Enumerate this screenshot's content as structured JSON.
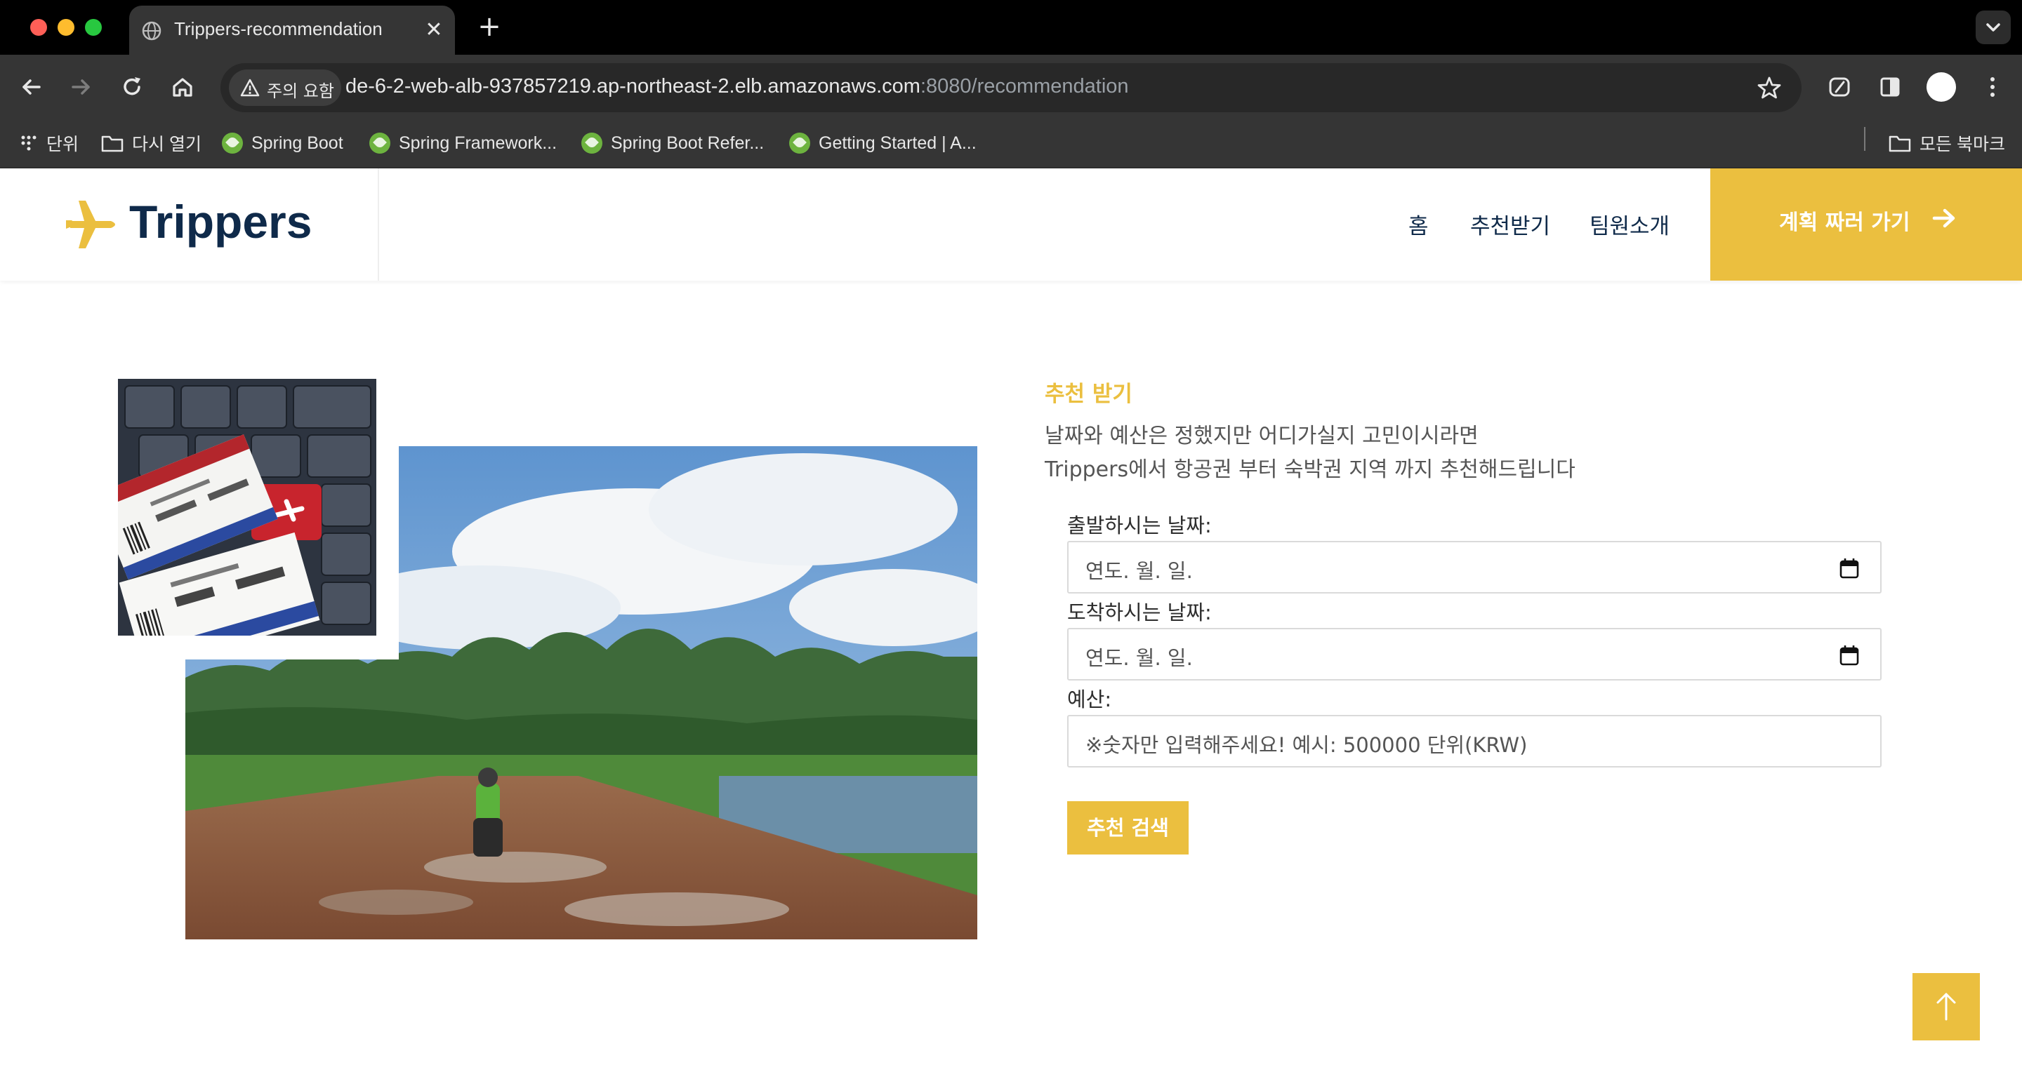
{
  "browser": {
    "tab_title": "Trippers-recommendation",
    "new_tab_symbol": "+",
    "close_symbol": "✕",
    "security_chip": "주의 요함",
    "url_host": "de-6-2-web-alb-937857219.ap-northeast-2.elb.amazonaws.com",
    "url_rest": ":8080/recommendation",
    "bookmarks": [
      {
        "label": "단위",
        "icon": "apps-grid-icon"
      },
      {
        "label": "다시 열기",
        "icon": "folder-icon"
      },
      {
        "label": "Spring Boot",
        "icon": "spring-leaf-icon"
      },
      {
        "label": "Spring Framework...",
        "icon": "spring-leaf-icon"
      },
      {
        "label": "Spring Boot Refer...",
        "icon": "spring-leaf-icon"
      },
      {
        "label": "Getting Started | A...",
        "icon": "spring-leaf-icon"
      }
    ],
    "all_bookmarks": "모든 북마크"
  },
  "site": {
    "logo_text": "Trippers",
    "nav": [
      "홈",
      "추천받기",
      "팀원소개"
    ],
    "cta_label": "계획 짜러 가기",
    "accent_color": "#ebbf3f",
    "navy_color": "#0f2a4a"
  },
  "form": {
    "section_label": "추천 받기",
    "intro_line1": "날짜와 예산은 정했지만 어디가실지 고민이시라면",
    "intro_line2": "Trippers에서 항공권 부터 숙박권 지역 까지 추천해드립니다",
    "departure_label": "출발하시는 날짜:",
    "departure_placeholder": "연도. 월. 일.",
    "arrival_label": "도착하시는 날짜:",
    "arrival_placeholder": "연도. 월. 일.",
    "budget_label": "예산:",
    "budget_placeholder": "※숫자만 입력해주세요! 예시: 500000 단위(KRW)",
    "submit_label": "추천 검색"
  }
}
